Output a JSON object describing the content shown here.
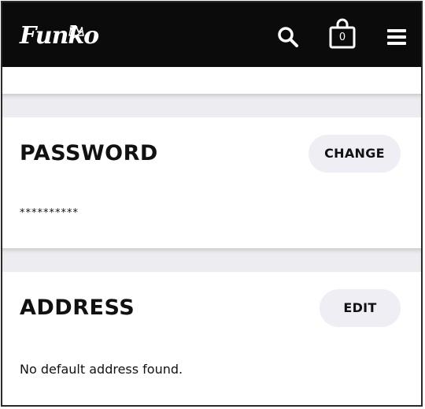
{
  "header": {
    "logo_text": "Funko",
    "cart_count": "0",
    "icons": [
      "search-icon",
      "shopping-bag-icon",
      "menu-icon"
    ]
  },
  "password": {
    "title": "PASSWORD",
    "button_label": "CHANGE",
    "value": "**********"
  },
  "address": {
    "title": "ADDRESS",
    "button_label": "EDIT",
    "empty_text": "No default address found."
  },
  "colors": {
    "header_bg": "#0b0b0b",
    "band_bg": "#ededf1",
    "pill_bg": "#efeef5",
    "text": "#111111"
  }
}
